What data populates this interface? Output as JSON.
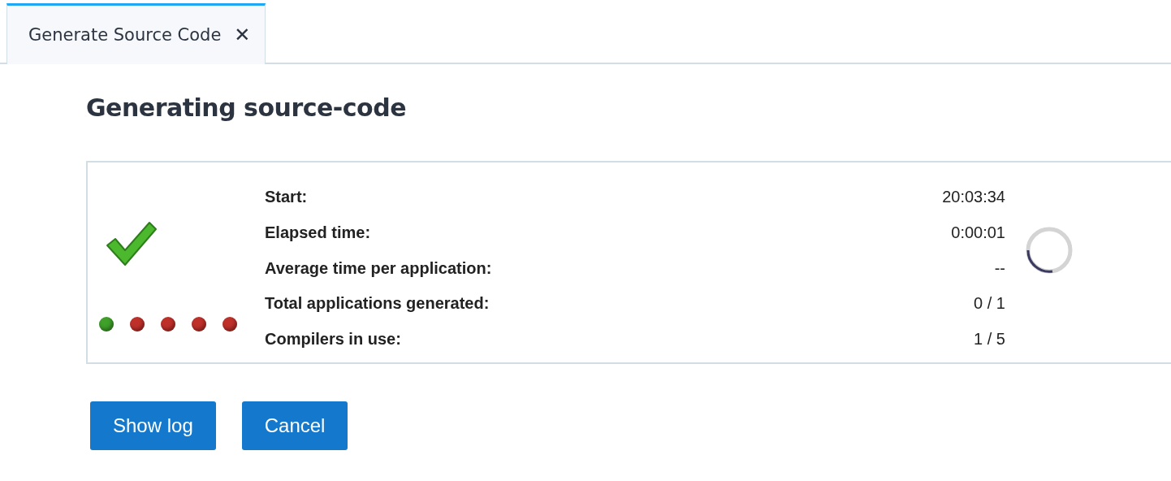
{
  "tabs": [
    {
      "label": "Generate Source Code",
      "selected": true,
      "close": "✕"
    }
  ],
  "heading": "Generating source-code",
  "compilers": [
    {
      "color": "#3fa02a"
    },
    {
      "color": "#c0302a"
    },
    {
      "color": "#c0302a"
    },
    {
      "color": "#c0302a"
    },
    {
      "color": "#c0302a"
    }
  ],
  "stats": [
    {
      "label": "Start:",
      "value": "20:03:34"
    },
    {
      "label": "Elapsed time:",
      "value": "0:00:01"
    },
    {
      "label": "Average time per application:",
      "value": "--"
    },
    {
      "label": "Total applications generated:",
      "value": "0 / 1"
    },
    {
      "label": "Compilers in use:",
      "value": "1 / 5"
    }
  ],
  "buttons": [
    "Show log",
    "Cancel"
  ]
}
